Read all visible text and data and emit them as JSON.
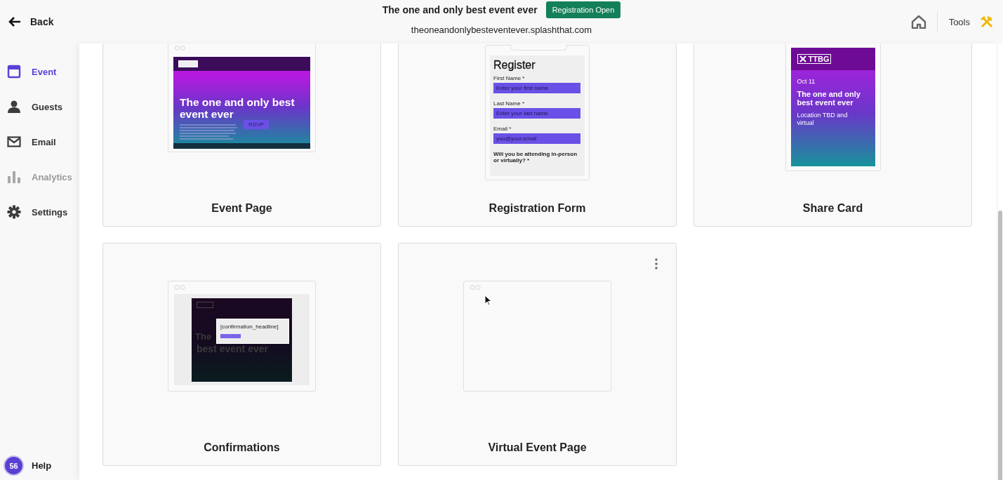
{
  "header": {
    "back": "Back",
    "event_title": "The one and only best event ever",
    "status_badge": "Registration Open",
    "url": "theoneandonlybesteventever.splashthat.com",
    "tools": "Tools"
  },
  "sidebar": {
    "items": [
      {
        "label": "Event",
        "selected": true,
        "disabled": false
      },
      {
        "label": "Guests",
        "selected": false,
        "disabled": false
      },
      {
        "label": "Email",
        "selected": false,
        "disabled": false
      },
      {
        "label": "Analytics",
        "selected": false,
        "disabled": true
      },
      {
        "label": "Settings",
        "selected": false,
        "disabled": false
      }
    ],
    "help": {
      "badge": "56",
      "label": "Help"
    }
  },
  "cards": [
    {
      "title": "Event Page",
      "kind": "event-page",
      "preview": {
        "headline": "The one and only best event ever",
        "button": "RSVP"
      }
    },
    {
      "title": "Registration Form",
      "kind": "registration-form",
      "preview": {
        "heading": "Register",
        "fields": [
          {
            "label": "First Name *",
            "placeholder": "Enter your first name"
          },
          {
            "label": "Last Name *",
            "placeholder": "Enter your last name"
          },
          {
            "label": "Email *",
            "placeholder": "you@your.email"
          }
        ],
        "question": "Will you be attending in-person or virtually? *"
      }
    },
    {
      "title": "Share Card",
      "kind": "share-card",
      "preview": {
        "logo": "TTBG",
        "date": "Oct 11",
        "headline": "The one and only best event ever",
        "location": "Location TBD and virtual"
      }
    },
    {
      "title": "Confirmations",
      "kind": "confirmation",
      "preview": {
        "modal_text": "[confirmation_headline]",
        "headline_parts": [
          "The",
          "best event ever"
        ]
      }
    },
    {
      "title": "Virtual Event Page",
      "kind": "blank",
      "menu": true
    }
  ]
}
